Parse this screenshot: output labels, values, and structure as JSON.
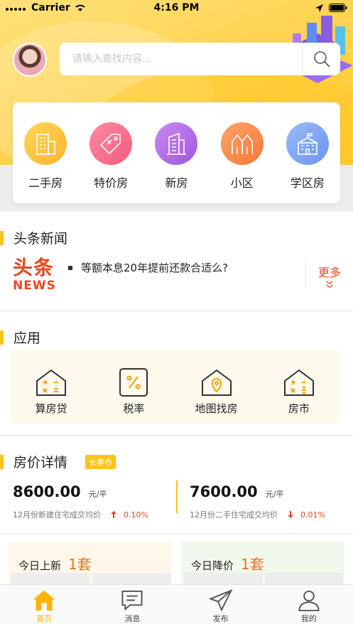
{
  "status_bar": {
    "carrier": "Carrier",
    "time": "4:16 PM"
  },
  "search": {
    "placeholder": "请输入查找内容..."
  },
  "categories": [
    {
      "label": "二手房",
      "color": "#ffc43d",
      "icon": "building-icon"
    },
    {
      "label": "特价房",
      "color": "#f86b8c",
      "icon": "price-tag-icon"
    },
    {
      "label": "新房",
      "color": "#b66ee8",
      "icon": "skyscraper-icon"
    },
    {
      "label": "小区",
      "color": "#fb8b4a",
      "icon": "houses-icon"
    },
    {
      "label": "学区房",
      "color": "#7fa7f3",
      "icon": "school-icon"
    }
  ],
  "news": {
    "title": "头条新闻",
    "logo_top": "头条",
    "logo_bottom": "NEWS",
    "headline": "等额本息20年提前还款合适么?",
    "more": "更多"
  },
  "apps": {
    "title": "应用",
    "items": [
      {
        "label": "算房贷",
        "icon": "calculator-house-icon"
      },
      {
        "label": "税率",
        "icon": "percent-icon"
      },
      {
        "label": "地图找房",
        "icon": "map-pin-house-icon"
      },
      {
        "label": "房市",
        "icon": "market-house-icon"
      }
    ]
  },
  "price": {
    "title": "房价详情",
    "city": "长春市",
    "new_home": {
      "value": "8600.00",
      "unit": "元/平",
      "desc": "12月份新建住宅成交均价",
      "change": "0.10%",
      "direction": "up"
    },
    "second_hand": {
      "value": "7600.00",
      "unit": "元/平",
      "desc": "12月份二手住宅成交均价",
      "change": "0.01%",
      "direction": "down"
    }
  },
  "today": {
    "new_label": "今日上新",
    "new_count": "1套",
    "drop_label": "今日降价",
    "drop_count": "1套"
  },
  "tabs": [
    {
      "label": "首页",
      "icon": "home-icon",
      "active": true
    },
    {
      "label": "消息",
      "icon": "message-icon",
      "active": false
    },
    {
      "label": "发布",
      "icon": "send-icon",
      "active": false
    },
    {
      "label": "我的",
      "icon": "user-icon",
      "active": false
    }
  ],
  "colors": {
    "accent": "#ffc21a",
    "orange": "#f0701e",
    "red": "#e8481f"
  }
}
